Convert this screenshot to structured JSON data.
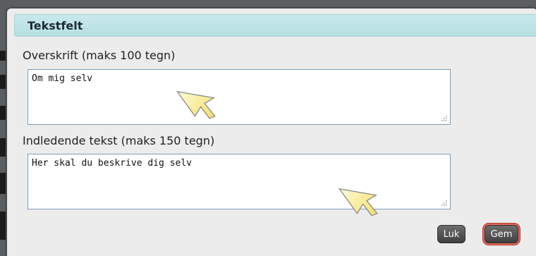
{
  "dialog": {
    "title": "Tekstfelt",
    "heading_label": "Overskrift (maks 100 tegn)",
    "heading_value": "Om mig selv",
    "intro_label": "Indledende tekst (maks 150 tegn)",
    "intro_value": "Her skal du beskrive dig selv",
    "close_label": "Luk",
    "save_label": "Gem"
  },
  "colors": {
    "titlebar": "#bfe3e7",
    "dialog_bg": "#ececec",
    "button": "#555555",
    "save_highlight_ring": "#d9483a",
    "cursor_fill": "#fff3a8"
  }
}
